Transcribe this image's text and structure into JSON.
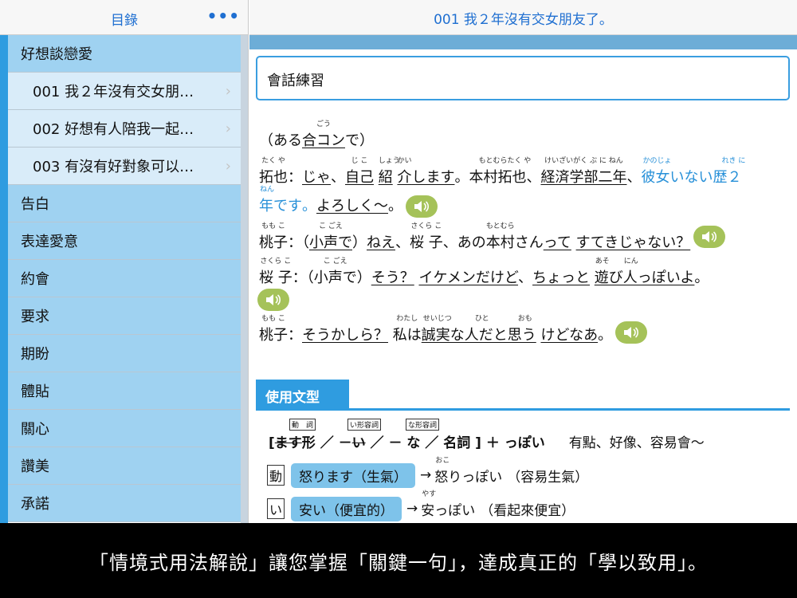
{
  "sidebar": {
    "title": "目錄",
    "more": "•••",
    "category": "好想談戀愛",
    "sub_items": [
      "001 我２年沒有交女朋…",
      "002 好想有人陪我一起…",
      "003 有沒有好對象可以…"
    ],
    "categories": [
      "告白",
      "表達愛意",
      "約會",
      "要求",
      "期盼",
      "體貼",
      "關心",
      "讚美",
      "承諾"
    ]
  },
  "header": {
    "title": "001 我２年沒有交女朋友了。"
  },
  "section_title": "會話練習",
  "dialogue": {
    "scene_pre": "（ある",
    "scene_kanji": "合コン",
    "scene_kanji_ruby": "ごう",
    "scene_post": "で）",
    "l1": {
      "speaker": "拓也",
      "speaker_ruby": "たく や",
      "colon": "：",
      "t1": "じゃ",
      "t2": "、",
      "t3": "自己",
      "t3_ruby": "じ こ",
      "t4": "紹",
      "t4_ruby": "しょう",
      "t5": "介",
      "t5_ruby": "かい",
      "t6": "します",
      "t7": "。本村拓也",
      "t7_ruby": "もとむらたく や",
      "t8": "、",
      "t9": "経済学部二年",
      "t9_ruby": "けいざいがく ぶ に ねん",
      "t10": "、",
      "t11": "彼女いない歴２",
      "t11_ruby_a": "かのじょ",
      "t11_ruby_b": "れき に",
      "t12": "年です",
      "t12_ruby": "ねん",
      "t13": "。",
      "t14": "よろしく〜",
      "t15": "。"
    },
    "l2": {
      "speaker": "桃子",
      "speaker_ruby": "もも こ",
      "colon": "：（",
      "t1": "小声で",
      "t1_ruby": "こ ごえ",
      "t2": "）",
      "t3": "ねえ",
      "t4": "、",
      "t5": "桜 子",
      "t5_ruby": "さくら こ",
      "t6": "、あの",
      "t7": "本村",
      "t7_ruby": "もとむら",
      "t8": "さん",
      "t9": "って",
      "t10": "すてきじゃない？"
    },
    "l3": {
      "speaker": "桜 子",
      "speaker_ruby": "さくら こ",
      "colon": "：（",
      "t1": "小声で",
      "t1_ruby": "こ ごえ",
      "t2": "）",
      "t3": "そう？",
      "t4": "イケメンだけど",
      "t5": "、",
      "t6": "ちょっと",
      "t7": "遊び人っぽいよ",
      "t7_ruby_a": "あそ",
      "t7_ruby_b": "にん",
      "t8": "。"
    },
    "l4": {
      "speaker": "桃子",
      "speaker_ruby": "もも こ",
      "colon": "：",
      "t1": "そうかしら？",
      "t2": "私は",
      "t2_ruby": "わたし",
      "t3": "誠実な人だと思う",
      "t3_ruby_a": "せいじつ",
      "t3_ruby_b": "ひと",
      "t3_ruby_c": "おも",
      "t4": "けどなあ",
      "t5": "。"
    }
  },
  "grammar": {
    "tab": "使用文型",
    "tag_verb": "動　詞",
    "tag_i_adj": "い形容詞",
    "tag_na_adj": "な形容詞",
    "pattern_open": "[",
    "pattern_masu": "ます",
    "pattern_1": "形 ／ －",
    "pattern_i": "い",
    "pattern_2": "／ － な ／ 名詞 ] ＋ っぽい",
    "pattern_meaning": "有點、好像、容易會〜",
    "examples": [
      {
        "badge": "動",
        "pill": "怒ります（生氣）",
        "arrow": "→",
        "result": "怒りっぽい",
        "result_ruby": "おこ",
        "meaning": "（容易生氣）"
      },
      {
        "badge": "い",
        "pill": "安い（便宜的）",
        "arrow": "→",
        "result": "安っぽい",
        "result_ruby": "やす",
        "meaning": "（看起來便宜）"
      }
    ]
  },
  "banner": "「情境式用法解說」讓您掌握「關鍵一句」，達成真正的「學以致用」。",
  "colors": {
    "accent": "#2f9ce0",
    "sidebar_category": "#9fd2f1",
    "sidebar_sub": "#d9ecf9",
    "speaker": "#a5c259",
    "header_text": "#1f6fd1"
  },
  "icons": {
    "speaker": "speaker-icon",
    "chevron": "chevron-right-icon",
    "more": "more-icon"
  }
}
